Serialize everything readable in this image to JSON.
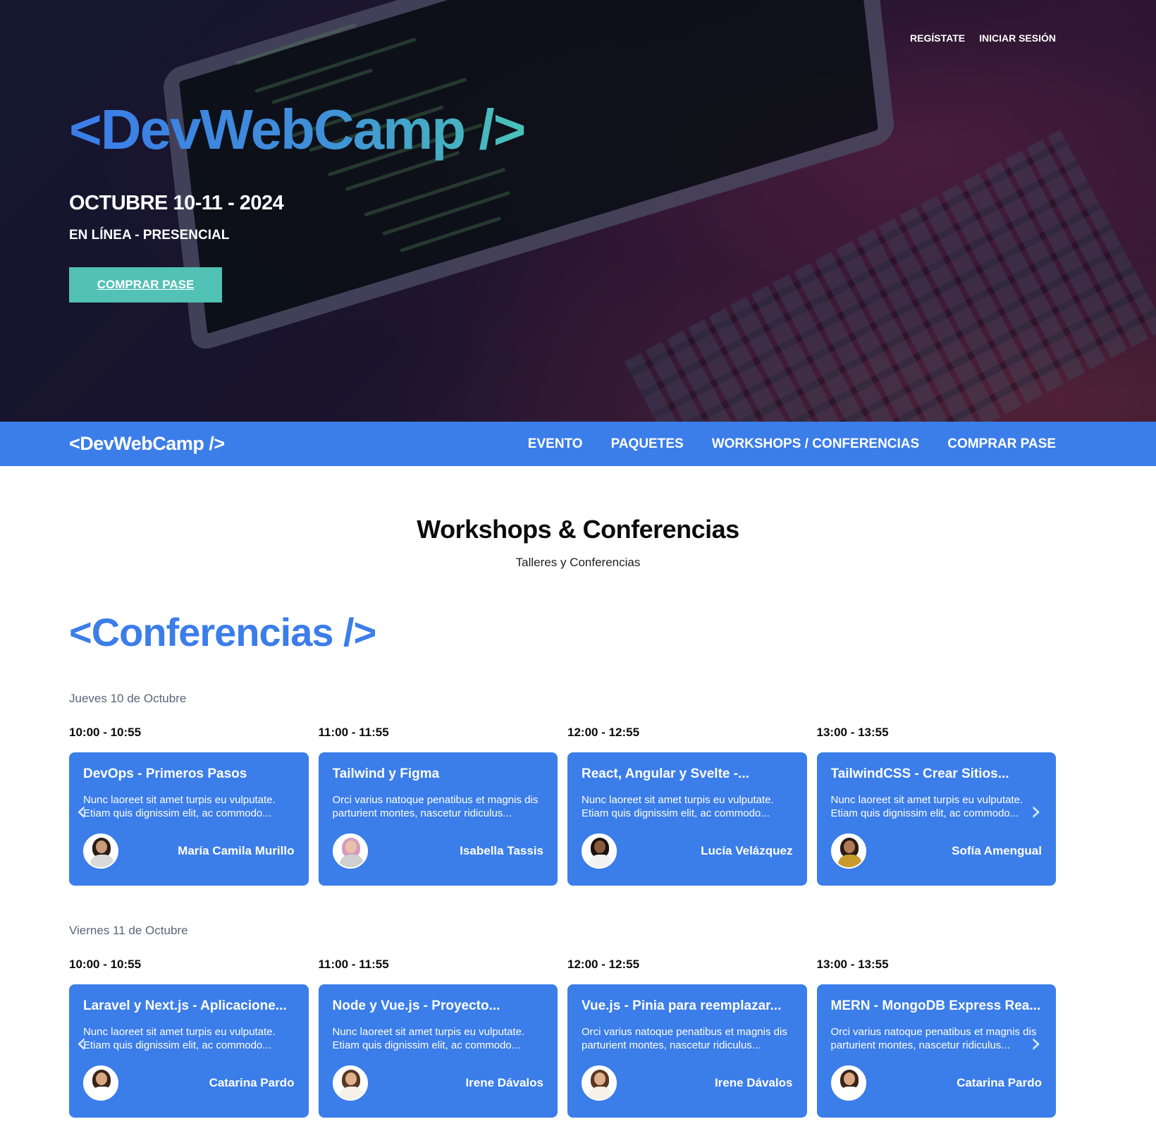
{
  "top_links": {
    "register": "REGÍSTATE",
    "login": "INICIAR SESIÓN"
  },
  "hero": {
    "logo": "<DevWebCamp />",
    "date": "OCTUBRE 10-11 - 2024",
    "mode": "EN LÍNEA - PRESENCIAL",
    "cta": "COMPRAR PASE"
  },
  "nav": {
    "logo": "<DevWebCamp />",
    "items": [
      "EVENTO",
      "PAQUETES",
      "WORKSHOPS / CONFERENCIAS",
      "COMPRAR PASE"
    ]
  },
  "section": {
    "title": "Workshops & Conferencias",
    "subtitle": "Talleres y Conferencias",
    "conf_heading": "<Conferencias />"
  },
  "days": [
    {
      "label": "Jueves 10 de Octubre",
      "times": [
        "10:00 - 10:55",
        "11:00 - 11:55",
        "12:00 - 12:55",
        "13:00 - 13:55"
      ],
      "cards": [
        {
          "title": "DevOps - Primeros Pasos",
          "desc": "Nunc laoreet sit amet turpis eu vulputate. Etiam quis dignissim elit, ac commodo...",
          "speaker": "María Camila Murillo"
        },
        {
          "title": "Tailwind y Figma",
          "desc": "Orci varius natoque penatibus et magnis dis parturient montes, nascetur ridiculus...",
          "speaker": "Isabella Tassis"
        },
        {
          "title": "React, Angular y Svelte -...",
          "desc": "Nunc laoreet sit amet turpis eu vulputate. Etiam quis dignissim elit, ac commodo...",
          "speaker": "Lucía Velázquez"
        },
        {
          "title": "TailwindCSS - Crear Sitios...",
          "desc": "Nunc laoreet sit amet turpis eu vulputate. Etiam quis dignissim elit, ac commodo...",
          "speaker": "Sofía Amengual"
        }
      ]
    },
    {
      "label": "Viernes 11 de Octubre",
      "times": [
        "10:00 - 10:55",
        "11:00 - 11:55",
        "12:00 - 12:55",
        "13:00 - 13:55"
      ],
      "cards": [
        {
          "title": "Laravel y Next.js - Aplicacione...",
          "desc": "Nunc laoreet sit amet turpis eu vulputate. Etiam quis dignissim elit, ac commodo...",
          "speaker": "Catarina Pardo"
        },
        {
          "title": "Node y Vue.js - Proyecto...",
          "desc": "Nunc laoreet sit amet turpis eu vulputate. Etiam quis dignissim elit, ac commodo...",
          "speaker": "Irene Dávalos"
        },
        {
          "title": "Vue.js - Pinia para reemplazar...",
          "desc": "Orci varius natoque penatibus et magnis dis parturient montes, nascetur ridiculus...",
          "speaker": "Irene Dávalos"
        },
        {
          "title": "MERN - MongoDB Express Rea...",
          "desc": "Orci varius natoque penatibus et magnis dis parturient montes, nascetur ridiculus...",
          "speaker": "Catarina Pardo"
        }
      ]
    }
  ],
  "colors": {
    "brand_blue": "#3b7de9",
    "teal": "#52c1b6"
  },
  "icons": {
    "prev": "chevron-left-icon",
    "next": "chevron-right-icon"
  }
}
